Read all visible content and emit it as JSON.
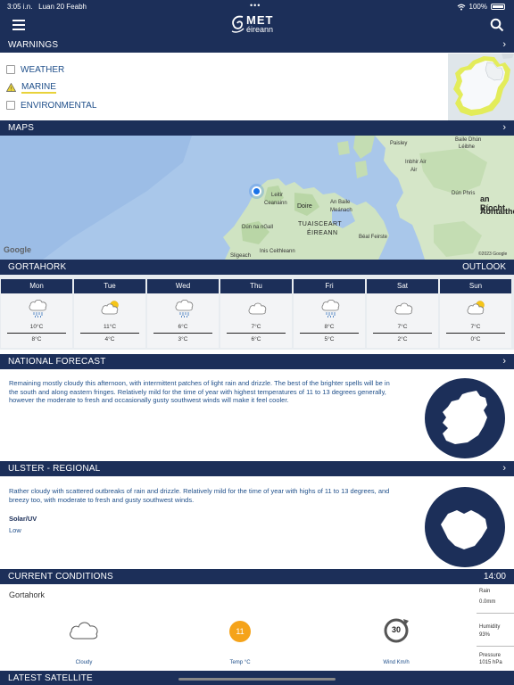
{
  "status": {
    "time": "3:05 i.n.",
    "date": "Luan 20 Feabh",
    "battery": "100%"
  },
  "header": {
    "logo_top": "MET",
    "logo_bottom": "éireann"
  },
  "warnings": {
    "title": "WARNINGS",
    "items": [
      {
        "label": "WEATHER",
        "active": false
      },
      {
        "label": "MARINE",
        "active": true
      },
      {
        "label": "ENVIRONMENTAL",
        "active": false
      }
    ]
  },
  "maps": {
    "title": "MAPS",
    "labels": {
      "baile_dhun": "Baile Dhún",
      "leibhe": "Léibhe",
      "paisley": "Paisley",
      "inbhir_air": "Inbhir Air",
      "air": "Air",
      "dun_phris": "Dún Phris",
      "an_riocht": "an Ríocht",
      "aontaithe": "Aontaithe",
      "leitir": "Leitir",
      "ceanainn": "Ceanainn",
      "doire": "Doire",
      "an_baile": "An Baile",
      "meanach": "Meánach",
      "dun_na_ngall": "Dún na nGall",
      "tuaisceart": "TUAISCEART",
      "eireann": "ÉIREANN",
      "beal_feirste": "Béal Feirste",
      "sligeach": "Sligeach",
      "inis_ceithleann": "Inis Ceithleann",
      "google": "Google",
      "copyright": "©2023 Google"
    }
  },
  "forecast": {
    "location": "GORTAHORK",
    "outlook": "OUTLOOK",
    "days": [
      {
        "day": "Mon",
        "icon": "rain-cloud-icon",
        "high": "10°C",
        "low": "8°C"
      },
      {
        "day": "Tue",
        "icon": "sun-cloud-icon",
        "high": "11°C",
        "low": "4°C"
      },
      {
        "day": "Wed",
        "icon": "rain-cloud-icon",
        "high": "6°C",
        "low": "3°C"
      },
      {
        "day": "Thu",
        "icon": "cloud-icon",
        "high": "7°C",
        "low": "6°C"
      },
      {
        "day": "Fri",
        "icon": "rain-cloud-icon",
        "high": "8°C",
        "low": "5°C"
      },
      {
        "day": "Sat",
        "icon": "cloud-icon",
        "high": "7°C",
        "low": "2°C"
      },
      {
        "day": "Sun",
        "icon": "sun-cloud-icon",
        "high": "7°C",
        "low": "0°C"
      }
    ]
  },
  "national": {
    "title": "NATIONAL FORECAST",
    "lines": [
      "Remaining mostly cloudy this afternoon, with intermittent patches of light rain and drizzle. The best of the brighter spells will be in",
      "the south and along eastern fringes.  Relatively mild for the time of year with highest temperatures of 11 to 13 degrees generally,",
      "however the moderate to fresh and occasionally gusty southwest winds will make it feel cooler."
    ]
  },
  "regional": {
    "title": "ULSTER - REGIONAL",
    "lines": [
      "Rather cloudy with scattered outbreaks of rain and drizzle. Relatively mild for the time of year with highs of 11 to 13 degrees, and",
      "breezy too, with moderate to fresh and gusty southwest winds."
    ],
    "solar_title": "Solar/UV",
    "solar_value": "Low"
  },
  "current": {
    "title": "CURRENT CONDITIONS",
    "time": "14:00",
    "location": "Gortahork",
    "condition": "Cloudy",
    "temp": "11",
    "temp_label": "Temp °C",
    "wind": "30",
    "wind_label": "Wind Km/h",
    "rain_label": "Rain",
    "rain_value": "0.0mm",
    "humidity_label": "Humidity",
    "humidity_value": "93%",
    "pressure_label": "Pressure",
    "pressure_value": "1015 hPa"
  },
  "satellite": {
    "title": "LATEST SATELLITE"
  }
}
